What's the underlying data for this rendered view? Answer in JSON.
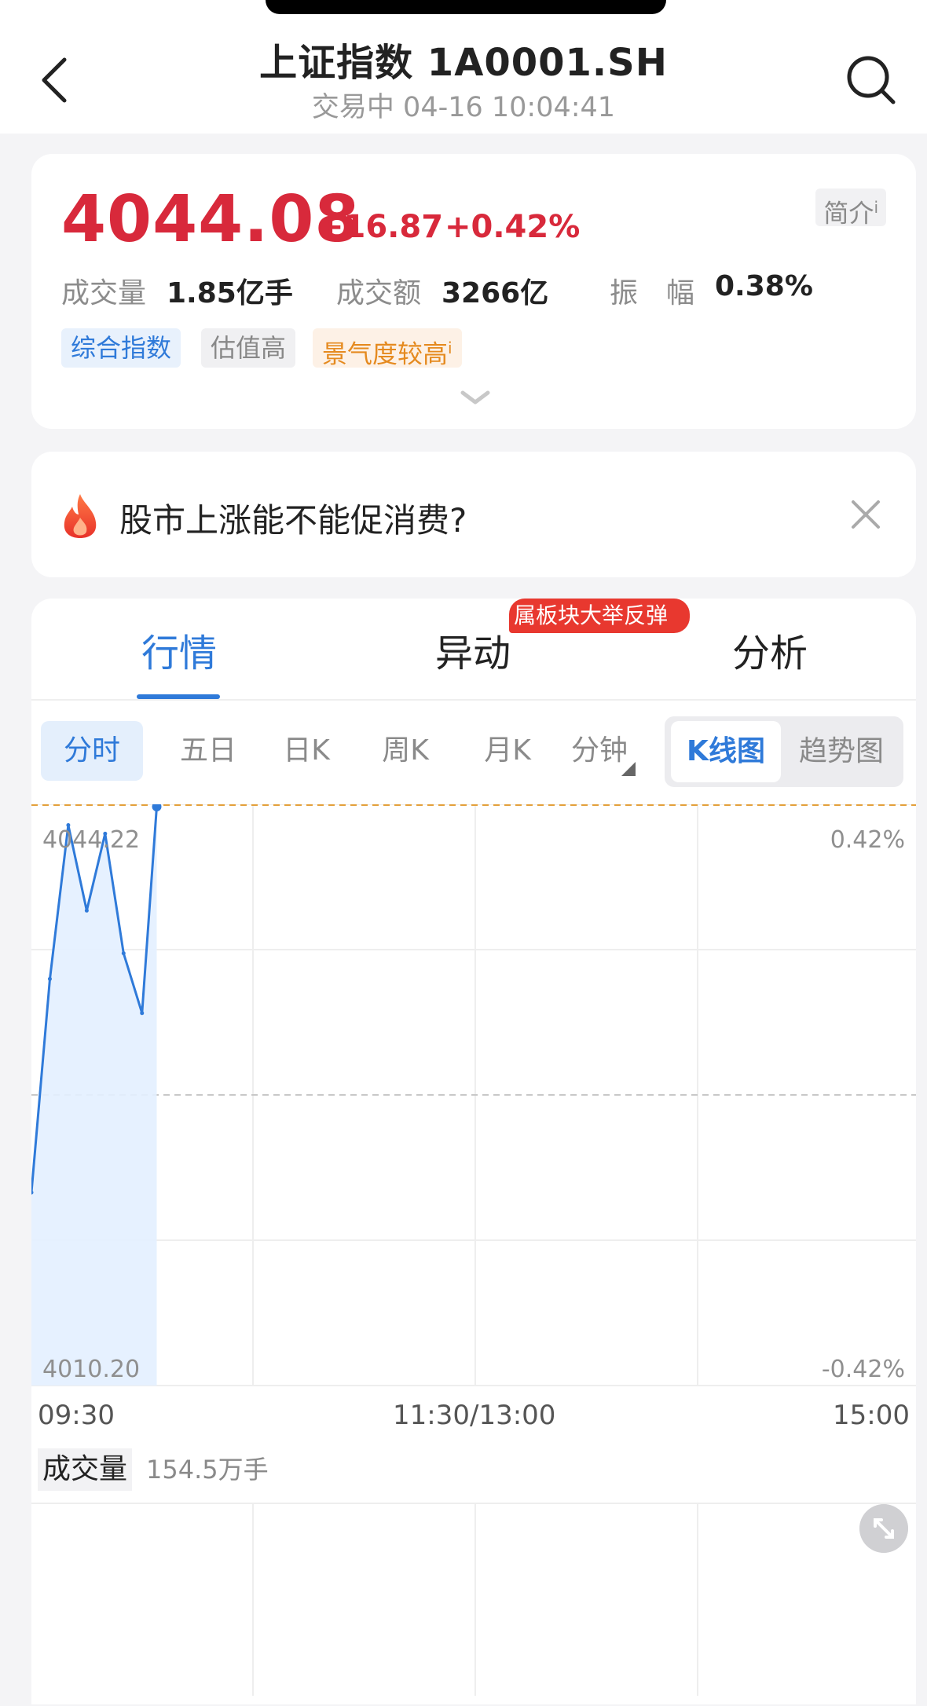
{
  "header": {
    "title": "上证指数 1A0001.SH",
    "subtitle": "交易中 04-16 10:04:41"
  },
  "quote": {
    "price": "4044.08",
    "change": "+16.87",
    "change_pct": "+0.42%",
    "intro_label": "简介",
    "info_mark": "i",
    "stats": [
      {
        "label": "成交量",
        "value": "1.85亿手"
      },
      {
        "label": "成交额",
        "value": "3266亿"
      },
      {
        "label": "振　幅",
        "value": "0.38%"
      }
    ],
    "tags": [
      "综合指数",
      "估值高",
      "景气度较高"
    ]
  },
  "topic": {
    "text": "股市上涨能不能促消费?"
  },
  "tabs": {
    "items": [
      "行情",
      "异动",
      "分析"
    ],
    "active": 0,
    "badge": "属板块大举反弹"
  },
  "periods": {
    "items": [
      "分时",
      "五日",
      "日K",
      "周K",
      "月K",
      "分钟"
    ],
    "active": 0
  },
  "view_toggle": {
    "on": "K线图",
    "off": "趋势图"
  },
  "colors": {
    "accent": "#2f7ad9",
    "up": "#d8293b",
    "down": "#1a9b6c"
  },
  "chart_data": {
    "type": "line",
    "title": "",
    "x_ticks": [
      "09:30",
      "11:30/13:00",
      "15:00"
    ],
    "x": [
      "09:30",
      "09:35",
      "09:40",
      "09:45",
      "09:50",
      "09:55",
      "10:00",
      "10:04"
    ],
    "series": [
      {
        "values": [
          4021.5,
          4034.0,
          4043.0,
          4038.0,
          4042.5,
          4035.5,
          4032.0,
          4044.08
        ]
      }
    ],
    "y_labels_left": {
      "top": "4044.22",
      "bottom": "4010.20"
    },
    "y_labels_right": {
      "top": "0.42%",
      "bottom": "-0.42%"
    },
    "ylim": [
      4010.2,
      4044.22
    ],
    "prev_close": 4027.21,
    "grid": true,
    "volume": {
      "label": "成交量",
      "value": "154.5万手"
    }
  }
}
